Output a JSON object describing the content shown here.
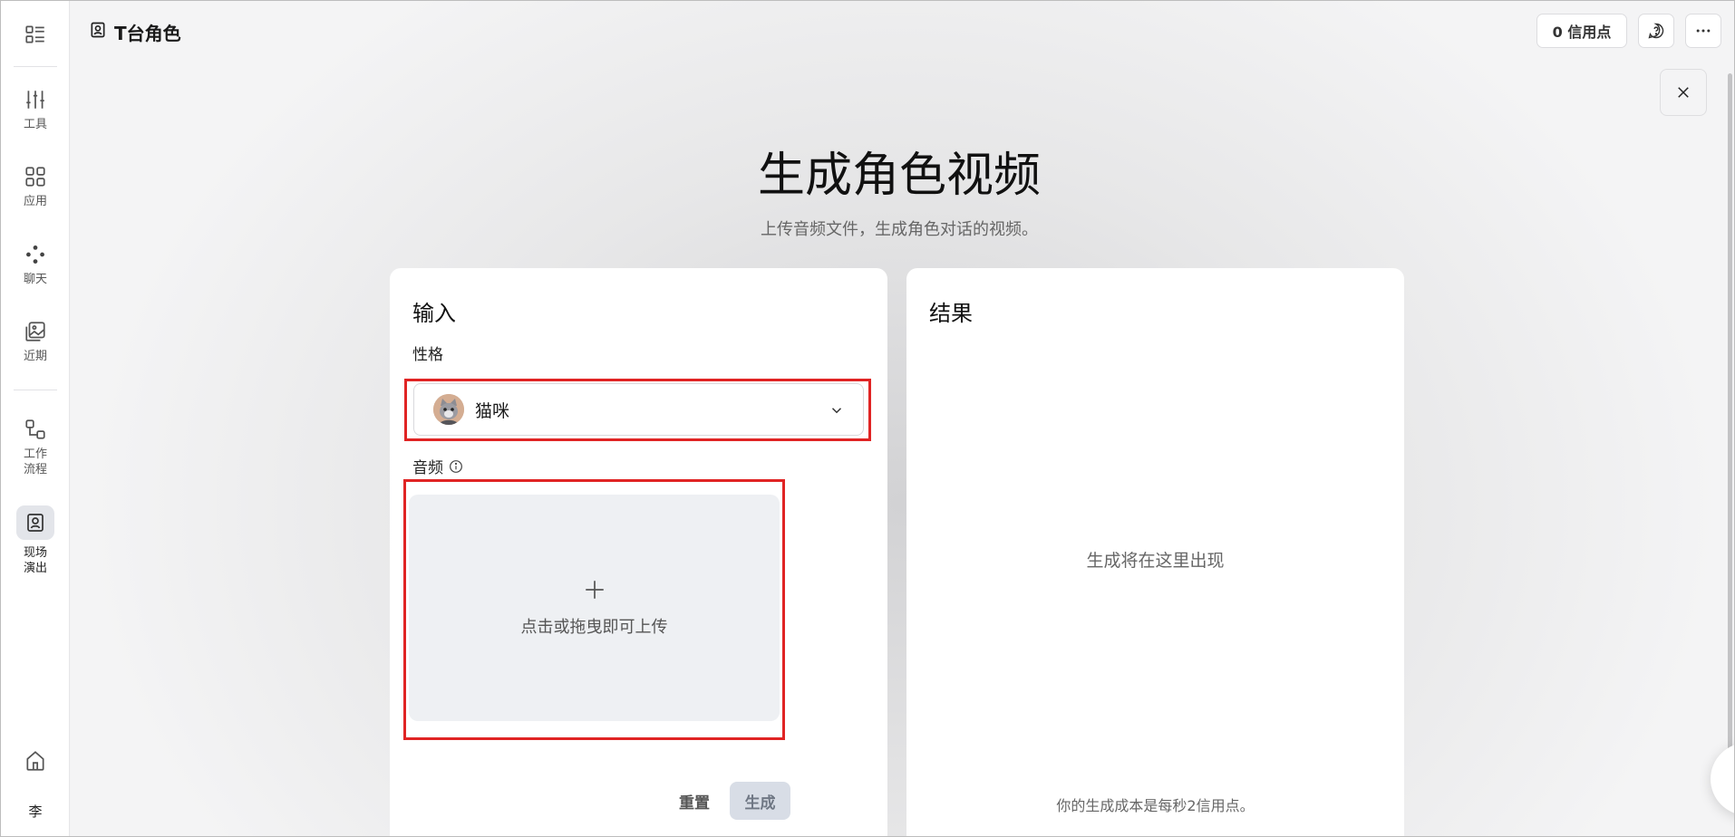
{
  "sidebar": {
    "items": [
      {
        "label": "工具",
        "icon": "sliders-icon"
      },
      {
        "label": "应用",
        "icon": "grid-icon"
      },
      {
        "label": "聊天",
        "icon": "dots-icon"
      },
      {
        "label": "近期",
        "icon": "images-icon"
      },
      {
        "label": "工作\n流程",
        "icon": "workflow-icon"
      },
      {
        "label": "现场\n演出",
        "icon": "portrait-icon"
      }
    ],
    "user_initial": "李"
  },
  "header": {
    "title": "T台角色",
    "credits": "0 信用点"
  },
  "hero": {
    "title": "生成角色视频",
    "subtitle": "上传音频文件，生成角色对话的视频。"
  },
  "input_panel": {
    "heading": "输入",
    "personality_label": "性格",
    "personality_value": "猫咪",
    "audio_label": "音频",
    "upload_text": "点击或拖曳即可上传",
    "reset_label": "重置",
    "generate_label": "生成"
  },
  "result_panel": {
    "heading": "结果",
    "placeholder": "生成将在这里出现",
    "cost_note": "你的生成成本是每秒2信用点。"
  },
  "colors": {
    "highlight": "#e02424",
    "generate_button": "#d8dde6",
    "dropzone": "#eef0f3"
  }
}
